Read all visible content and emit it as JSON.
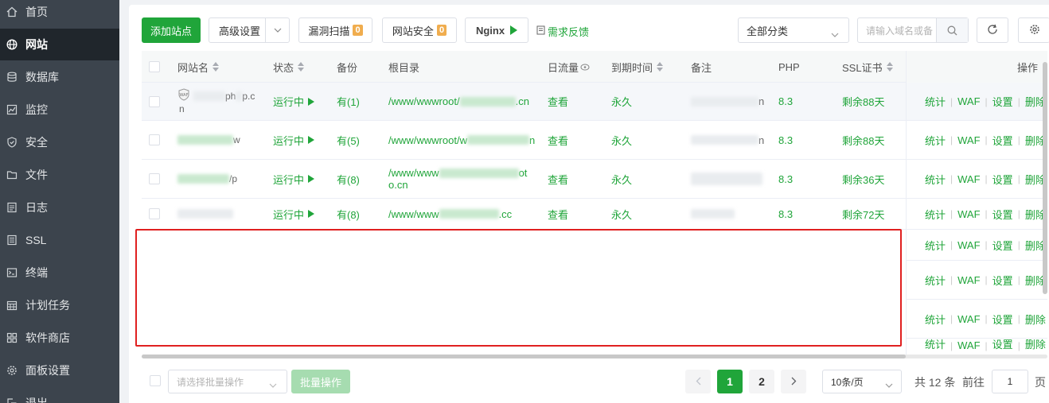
{
  "sidebar": {
    "items": [
      {
        "label": "首页",
        "icon": "home-icon"
      },
      {
        "label": "网站",
        "icon": "globe-icon"
      },
      {
        "label": "数据库",
        "icon": "database-icon"
      },
      {
        "label": "监控",
        "icon": "monitor-icon"
      },
      {
        "label": "安全",
        "icon": "shield-icon"
      },
      {
        "label": "文件",
        "icon": "folder-icon"
      },
      {
        "label": "日志",
        "icon": "log-icon"
      },
      {
        "label": "SSL",
        "icon": "ssl-icon"
      },
      {
        "label": "终端",
        "icon": "terminal-icon"
      },
      {
        "label": "计划任务",
        "icon": "calendar-icon"
      },
      {
        "label": "软件商店",
        "icon": "grid-icon"
      },
      {
        "label": "面板设置",
        "icon": "gear-icon"
      },
      {
        "label": "退出",
        "icon": "logout-icon"
      }
    ],
    "active_index": 1
  },
  "toolbar": {
    "add_site": "添加站点",
    "advanced": "高级设置",
    "vuln_scan": "漏洞扫描",
    "vuln_count": "0",
    "site_security": "网站安全",
    "security_count": "0",
    "nginx": "Nginx",
    "feedback": "需求反馈",
    "category": "全部分类",
    "search_placeholder": "请输入域名或备"
  },
  "table": {
    "headers": {
      "name": "网站名",
      "status": "状态",
      "backup": "备份",
      "root": "根目录",
      "traffic": "日流量",
      "expire": "到期时间",
      "remark": "备注",
      "php": "PHP",
      "ssl": "SSL证书",
      "ops": "操作"
    },
    "rows": [
      {
        "name_a": "ph",
        "name_b": "p.c",
        "name_c": "n",
        "status": "运行中",
        "backup": "有(1)",
        "root": "/www/wwwroot/",
        "root_tail": ".cn",
        "root_line2": "",
        "traffic": "查看",
        "expire": "永久",
        "remark_tail": "n",
        "php": "8.3",
        "ssl": "剩余88天"
      },
      {
        "name_a": "",
        "name_b": "w",
        "name_c": "",
        "status": "运行中",
        "backup": "有(5)",
        "root": "/www/wwwroot/w",
        "root_tail": "n",
        "root_line2": "",
        "traffic": "查看",
        "expire": "永久",
        "remark_tail": "n",
        "php": "8.3",
        "ssl": "剩余88天"
      },
      {
        "name_a": "",
        "name_b": "/p",
        "name_c": "",
        "status": "运行中",
        "backup": "有(8)",
        "root": "/www/www",
        "root_tail": "ot",
        "root_line2": "o.cn",
        "traffic": "查看",
        "expire": "永久",
        "remark_tail": "",
        "php": "8.3",
        "ssl": "剩余36天"
      },
      {
        "name_a": "",
        "name_b": "",
        "name_c": "",
        "status": "运行中",
        "backup": "有(8)",
        "root": "/www/www",
        "root_tail": ".cc",
        "root_line2": "",
        "traffic": "查看",
        "expire": "永久",
        "remark_tail": "",
        "php": "8.3",
        "ssl": "剩余72天"
      }
    ],
    "ops": {
      "stats": "统计",
      "waf": "WAF",
      "settings": "设置",
      "delete": "删除"
    }
  },
  "footer": {
    "batch_placeholder": "请选择批量操作",
    "batch_button": "批量操作",
    "page_1": "1",
    "page_2": "2",
    "page_size": "10条/页",
    "total": "共 12 条",
    "goto": "前往",
    "goto_value": "1",
    "page_unit": "页"
  },
  "colors": {
    "accent": "#20a53a",
    "sidebar": "#3c444d",
    "highlight_box": "#e02020",
    "badge": "#f0ad4e"
  }
}
